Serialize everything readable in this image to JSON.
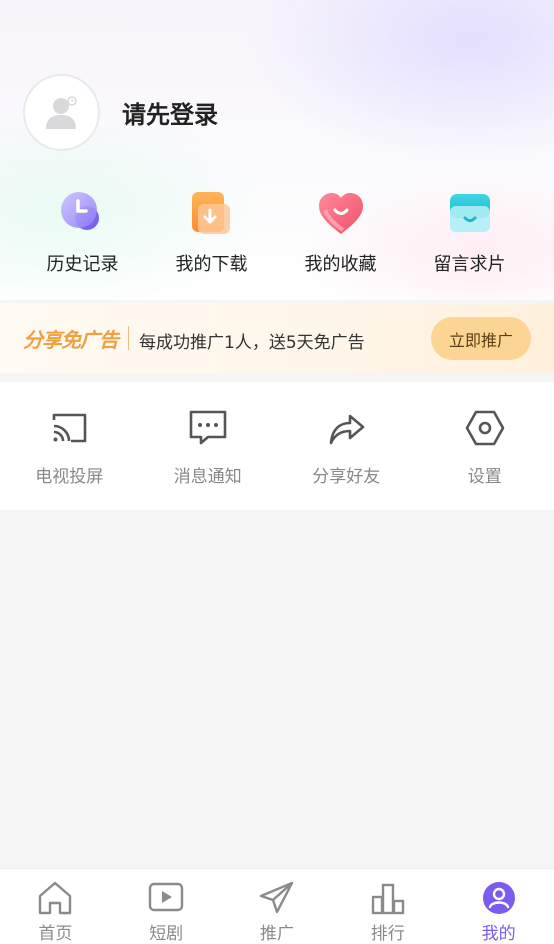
{
  "profile": {
    "login_prompt": "请先登录"
  },
  "quick_actions": [
    {
      "label": "历史记录",
      "icon": "history-clock-icon"
    },
    {
      "label": "我的下载",
      "icon": "download-icon"
    },
    {
      "label": "我的收藏",
      "icon": "heart-favorite-icon"
    },
    {
      "label": "留言求片",
      "icon": "message-box-icon"
    }
  ],
  "promo": {
    "title": "分享免广告",
    "description": "每成功推广1人，送5天免广告",
    "button_label": "立即推广"
  },
  "tools": [
    {
      "label": "电视投屏",
      "icon": "cast-icon"
    },
    {
      "label": "消息通知",
      "icon": "chat-bubble-icon"
    },
    {
      "label": "分享好友",
      "icon": "share-arrow-icon"
    },
    {
      "label": "设置",
      "icon": "settings-hexagon-icon"
    }
  ],
  "tabbar": {
    "active": "我的",
    "items": [
      {
        "label": "首页",
        "icon": "home-icon"
      },
      {
        "label": "短剧",
        "icon": "play-video-icon"
      },
      {
        "label": "推广",
        "icon": "paper-plane-icon"
      },
      {
        "label": "排行",
        "icon": "bar-chart-icon"
      },
      {
        "label": "我的",
        "icon": "user-profile-icon"
      }
    ]
  },
  "colors": {
    "accent": "#7a5cf0",
    "promo_orange": "#f0a040",
    "promo_button": "#fcd493",
    "muted_text": "#888888"
  }
}
